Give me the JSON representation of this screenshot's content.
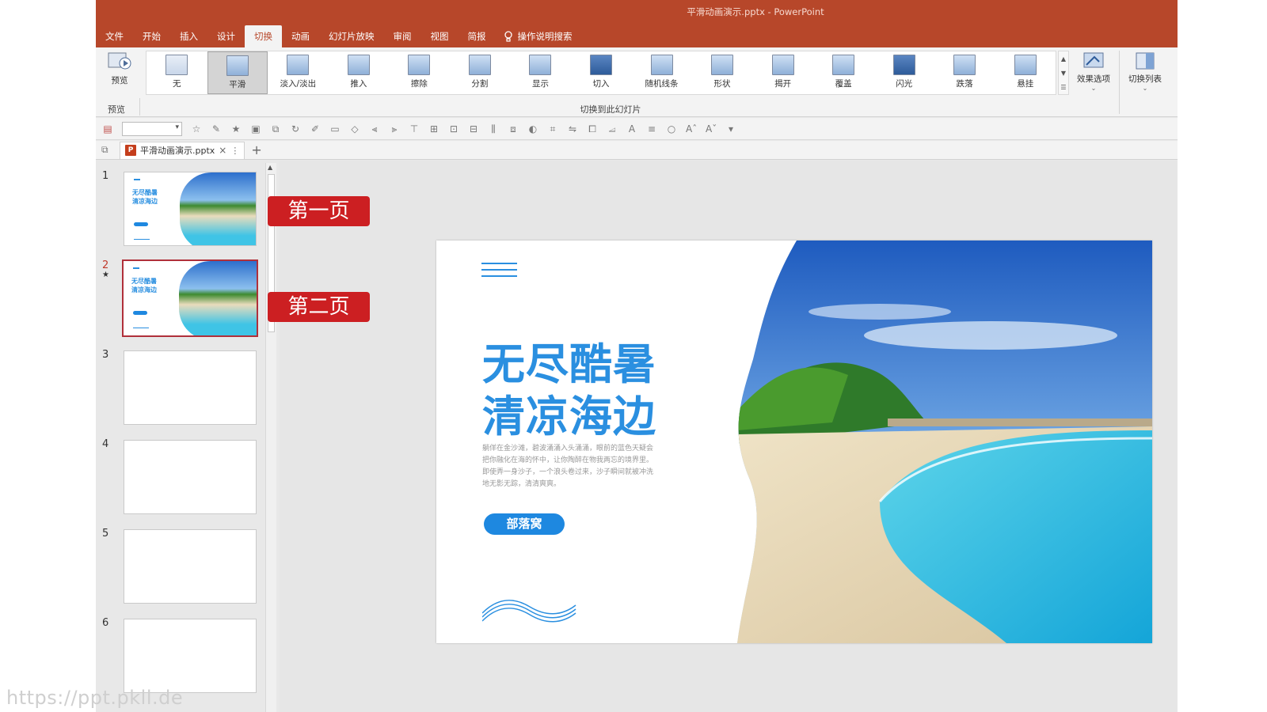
{
  "window": {
    "title": "平滑动画演示.pptx  -  PowerPoint"
  },
  "menu": {
    "tabs": [
      "文件",
      "开始",
      "插入",
      "设计",
      "切换",
      "动画",
      "幻灯片放映",
      "审阅",
      "视图",
      "简报"
    ],
    "active": "切换",
    "tell_me": "操作说明搜索"
  },
  "ribbon": {
    "preview_label": "预览",
    "preview_group": "预览",
    "transitions": [
      {
        "label": "无",
        "icon": "none-transition-icon"
      },
      {
        "label": "平滑",
        "icon": "morph-transition-icon",
        "selected": true
      },
      {
        "label": "淡入/淡出",
        "icon": "fade-transition-icon"
      },
      {
        "label": "推入",
        "icon": "push-transition-icon"
      },
      {
        "label": "擦除",
        "icon": "wipe-transition-icon"
      },
      {
        "label": "分割",
        "icon": "split-transition-icon"
      },
      {
        "label": "显示",
        "icon": "reveal-transition-icon"
      },
      {
        "label": "切入",
        "icon": "cut-transition-icon"
      },
      {
        "label": "随机线条",
        "icon": "random-bars-transition-icon"
      },
      {
        "label": "形状",
        "icon": "shape-transition-icon"
      },
      {
        "label": "揭开",
        "icon": "uncover-transition-icon"
      },
      {
        "label": "覆盖",
        "icon": "cover-transition-icon"
      },
      {
        "label": "闪光",
        "icon": "flash-transition-icon"
      },
      {
        "label": "跌落",
        "icon": "fall-transition-icon"
      },
      {
        "label": "悬挂",
        "icon": "drape-transition-icon"
      }
    ],
    "group_label": "切换到此幻灯片",
    "effect_options": "效果选项",
    "transition_list": "切换列表"
  },
  "document": {
    "tab_name": "平滑动画演示.pptx",
    "badge": "P"
  },
  "slides_panel": {
    "slides": [
      {
        "number": "1",
        "has_content": true
      },
      {
        "number": "2",
        "has_content": true,
        "selected": true,
        "star": "★"
      },
      {
        "number": "3",
        "has_content": false
      },
      {
        "number": "4",
        "has_content": false
      },
      {
        "number": "5",
        "has_content": false
      },
      {
        "number": "6",
        "has_content": false
      }
    ]
  },
  "callouts": {
    "first": "第一页",
    "second": "第二页"
  },
  "slide": {
    "title_line1": "无尽酷暑",
    "title_line2": "清凉海边",
    "body": "躺佯在金沙滩，碧波涌涌入头涌涌，眼前的蓝色天疑会把你融化在海的怀中，让你陶醉在物我两忘的境界里。即使弄一身沙子，一个浪头卷过来，沙子瞬间就被冲洗地无影无踪，清清爽爽。",
    "button": "部落窝"
  },
  "watermark": "https://ppt.pkll.de",
  "colors": {
    "accent": "#b7472a",
    "slide_title": "#2a8fe0",
    "callout": "#cc1f22"
  }
}
